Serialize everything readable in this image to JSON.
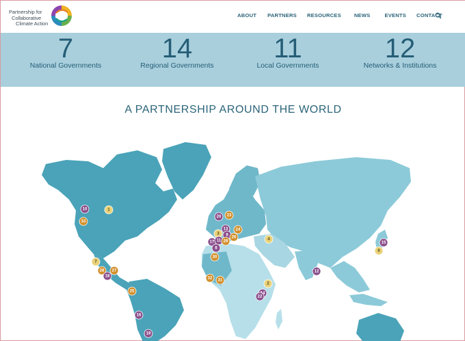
{
  "brand": {
    "line1": "Partnership for",
    "line2": "Collaborative",
    "line3": "Climate Action"
  },
  "nav": {
    "items": [
      "ABOUT",
      "PARTNERS",
      "RESOURCES",
      "NEWS",
      "EVENTS",
      "CONTACT"
    ],
    "search_icon": "search-icon"
  },
  "stats": [
    {
      "value": "7",
      "label": "National Governments"
    },
    {
      "value": "14",
      "label": "Regional Governments"
    },
    {
      "value": "11",
      "label": "Local Governments"
    },
    {
      "value": "12",
      "label": "Networks & Institutions"
    }
  ],
  "section": {
    "title": "A PARTNERSHIP AROUND THE WORLD"
  },
  "colors": {
    "stats_band": "#a9cfdd",
    "map_dark": "#4aa3b8",
    "map_light": "#8ccad9",
    "map_lighter": "#b6dfe9",
    "marker_purple": "#8b4f8c",
    "marker_orange": "#d18f2a",
    "marker_yellow": "#ead27a"
  },
  "markers": [
    {
      "label": "10",
      "kind": "purple"
    },
    {
      "label": "1",
      "kind": "yellow"
    },
    {
      "label": "33",
      "kind": "orange"
    },
    {
      "label": "7",
      "kind": "yellow"
    },
    {
      "label": "28",
      "kind": "orange"
    },
    {
      "label": "27",
      "kind": "orange"
    },
    {
      "label": "18",
      "kind": "purple"
    },
    {
      "label": "25",
      "kind": "orange"
    },
    {
      "label": "16",
      "kind": "purple"
    },
    {
      "label": "19",
      "kind": "purple"
    },
    {
      "label": "20",
      "kind": "purple"
    },
    {
      "label": "23",
      "kind": "orange"
    },
    {
      "label": "13",
      "kind": "purple"
    },
    {
      "label": "24",
      "kind": "orange"
    },
    {
      "label": "3",
      "kind": "yellow"
    },
    {
      "label": "9",
      "kind": "purple"
    },
    {
      "label": "26",
      "kind": "orange"
    },
    {
      "label": "17",
      "kind": "purple"
    },
    {
      "label": "11",
      "kind": "purple"
    },
    {
      "label": "29",
      "kind": "orange"
    },
    {
      "label": "8",
      "kind": "purple"
    },
    {
      "label": "4",
      "kind": "yellow"
    },
    {
      "label": "30",
      "kind": "orange"
    },
    {
      "label": "32",
      "kind": "orange"
    },
    {
      "label": "31",
      "kind": "orange"
    },
    {
      "label": "2",
      "kind": "yellow"
    },
    {
      "label": "14",
      "kind": "purple"
    },
    {
      "label": "22",
      "kind": "purple"
    },
    {
      "label": "12",
      "kind": "purple"
    },
    {
      "label": "15",
      "kind": "purple"
    },
    {
      "label": "6",
      "kind": "yellow"
    }
  ]
}
